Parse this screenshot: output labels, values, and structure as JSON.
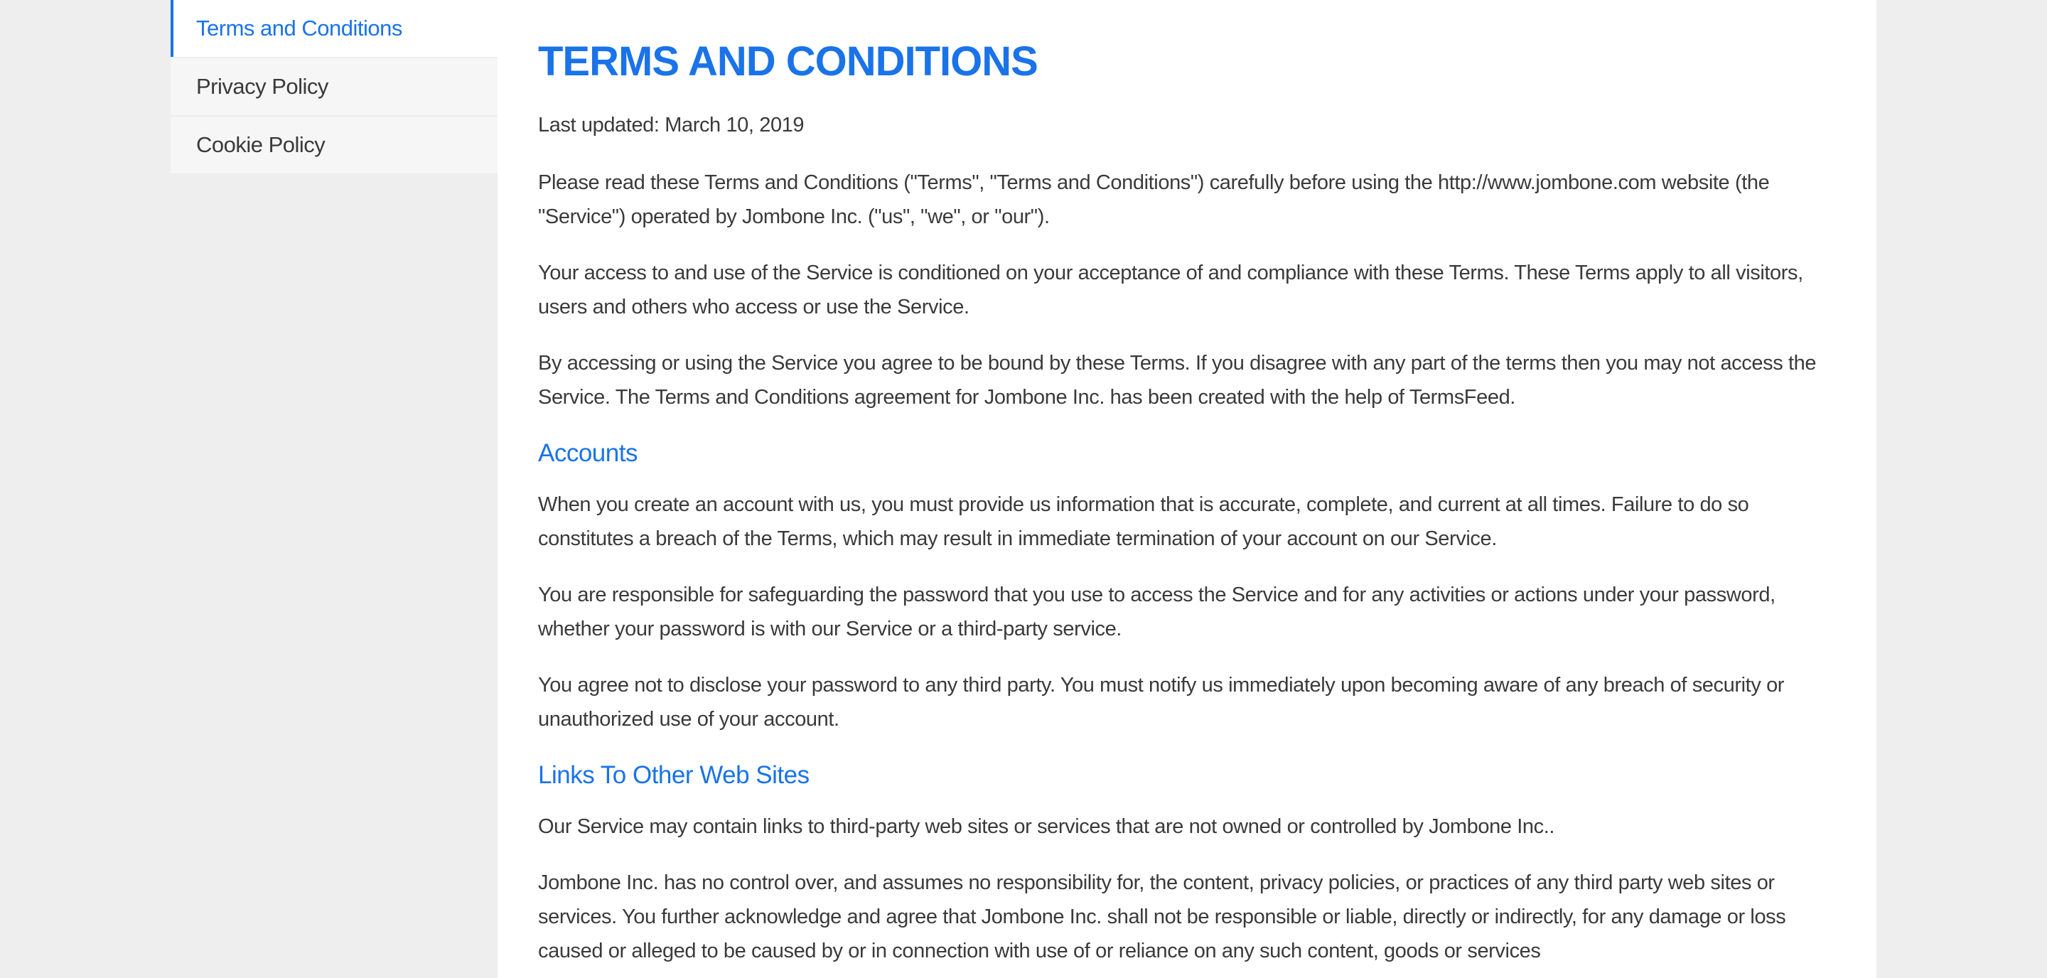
{
  "sidebar": {
    "items": [
      {
        "label": "Terms and Conditions",
        "active": true
      },
      {
        "label": "Privacy Policy",
        "active": false
      },
      {
        "label": "Cookie Policy",
        "active": false
      }
    ]
  },
  "main": {
    "title": "TERMS AND CONDITIONS",
    "last_updated": "Last updated: March 10, 2019",
    "intro": [
      "Please read these Terms and Conditions (\"Terms\", \"Terms and Conditions\") carefully before using the http://www.jombone.com website (the \"Service\") operated by Jombone Inc. (\"us\", \"we\", or \"our\").",
      "Your access to and use of the Service is conditioned on your acceptance of and compliance with these Terms. These Terms apply to all visitors, users and others who access or use the Service.",
      "By accessing or using the Service you agree to be bound by these Terms. If you disagree with any part of the terms then you may not access the Service. The Terms and Conditions agreement for Jombone Inc. has been created with the help of TermsFeed."
    ],
    "sections": [
      {
        "heading": "Accounts",
        "paragraphs": [
          "When you create an account with us, you must provide us information that is accurate, complete, and current at all times. Failure to do so constitutes a breach of the Terms, which may result in immediate termination of your account on our Service.",
          "You are responsible for safeguarding the password that you use to access the Service and for any activities or actions under your password, whether your password is with our Service or a third-party service.",
          "You agree not to disclose your password to any third party. You must notify us immediately upon becoming aware of any breach of security or unauthorized use of your account."
        ]
      },
      {
        "heading": "Links To Other Web Sites",
        "paragraphs": [
          "Our Service may contain links to third-party web sites or services that are not owned or controlled by Jombone Inc..",
          "Jombone Inc. has no control over, and assumes no responsibility for, the content, privacy policies, or practices of any third party web sites or services. You further acknowledge and agree that Jombone Inc. shall not be responsible or liable, directly or indirectly, for any damage or loss caused or alleged to be caused by or in connection with use of or reliance on any such content, goods or services"
        ]
      }
    ]
  },
  "colors": {
    "accent": "#1a73e8",
    "background": "#eeeeee",
    "text": "#3a3a3a"
  }
}
